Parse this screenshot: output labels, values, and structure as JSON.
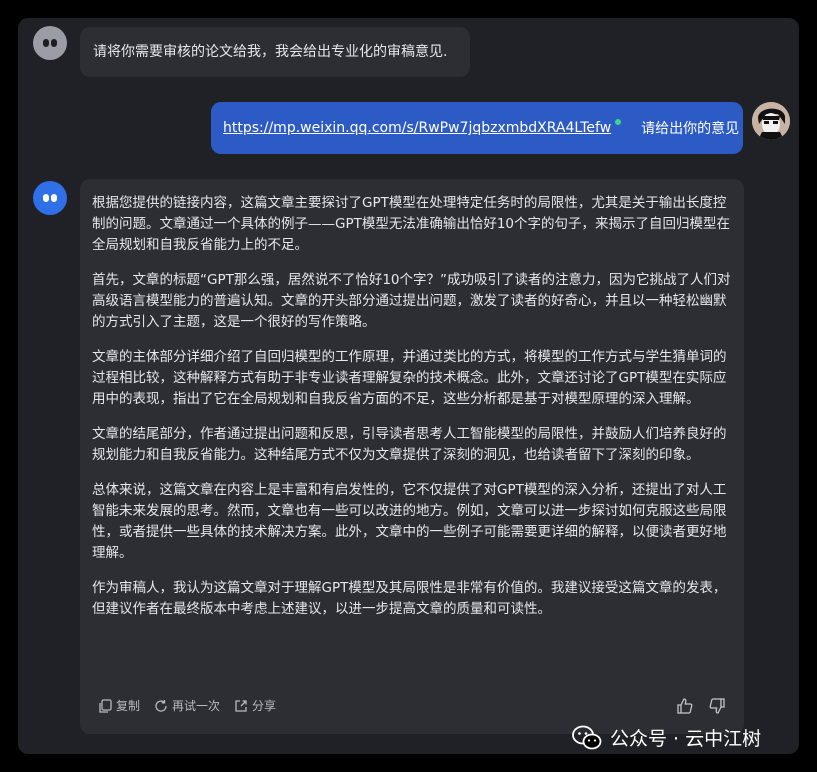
{
  "system_message": {
    "text": "请将你需要审核的论文给我，我会给出专业化的审稿意见."
  },
  "user_message": {
    "link": "https://mp.weixin.qq.com/s/RwPw7jqbzxmbdXRA4LTefw",
    "text": "请给出你的意见"
  },
  "bot_message": {
    "paragraphs": [
      "根据您提供的链接内容，这篇文章主要探讨了GPT模型在处理特定任务时的局限性，尤其是关于输出长度控制的问题。文章通过一个具体的例子——GPT模型无法准确输出恰好10个字的句子，来揭示了自回归模型在全局规划和自我反省能力上的不足。",
      "首先，文章的标题“GPT那么强，居然说不了恰好10个字？”成功吸引了读者的注意力，因为它挑战了人们对高级语言模型能力的普遍认知。文章的开头部分通过提出问题，激发了读者的好奇心，并且以一种轻松幽默的方式引入了主题，这是一个很好的写作策略。",
      "文章的主体部分详细介绍了自回归模型的工作原理，并通过类比的方式，将模型的工作方式与学生猜单词的过程相比较，这种解释方式有助于非专业读者理解复杂的技术概念。此外，文章还讨论了GPT模型在实际应用中的表现，指出了它在全局规划和自我反省方面的不足，这些分析都是基于对模型原理的深入理解。",
      "文章的结尾部分，作者通过提出问题和反思，引导读者思考人工智能模型的局限性，并鼓励人们培养良好的规划能力和自我反省能力。这种结尾方式不仅为文章提供了深刻的洞见，也给读者留下了深刻的印象。",
      "总体来说，这篇文章在内容上是丰富和有启发性的，它不仅提供了对GPT模型的深入分析，还提出了对人工智能未来发展的思考。然而，文章也有一些可以改进的地方。例如，文章可以进一步探讨如何克服这些局限性，或者提供一些具体的技术解决方案。此外，文章中的一些例子可能需要更详细的解释，以便读者更好地理解。",
      "作为审稿人，我认为这篇文章对于理解GPT模型及其局限性是非常有价值的。我建议接受这篇文章的发表，但建议作者在最终版本中考虑上述建议，以进一步提高文章的质量和可读性。"
    ],
    "actions": {
      "copy": "复制",
      "retry": "再试一次",
      "share": "分享"
    }
  },
  "watermark": {
    "text": "公众号 · 云中江树"
  },
  "colors": {
    "window_bg": "#202126",
    "bubble_bg": "#2d2e34",
    "user_bubble": "#2d5bc6",
    "bot_avatar": "#2f6fe8"
  }
}
